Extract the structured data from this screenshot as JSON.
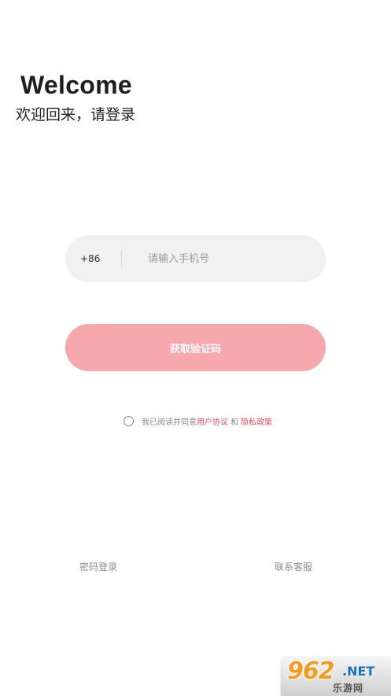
{
  "header": {
    "title": "Welcome",
    "subtitle": "欢迎回来，请登录"
  },
  "phone_field": {
    "country_code": "+86",
    "value": "",
    "placeholder": "请输入手机号"
  },
  "primary_button": {
    "label": "获取验证码"
  },
  "agreement": {
    "checked": false,
    "prefix": "我已阅读并同意",
    "user_agreement": "用户协议",
    "and": "和",
    "privacy_policy": "隐私政策"
  },
  "footer": {
    "password_login": "密码登录",
    "contact_service": "联系客服"
  },
  "watermark": {
    "logo_text": "962",
    "net_text": ".NET",
    "sub_text": "乐游网"
  },
  "colors": {
    "button": "#f6a8ad",
    "link": "#e0505f",
    "field_background": "#f1f1f1"
  }
}
